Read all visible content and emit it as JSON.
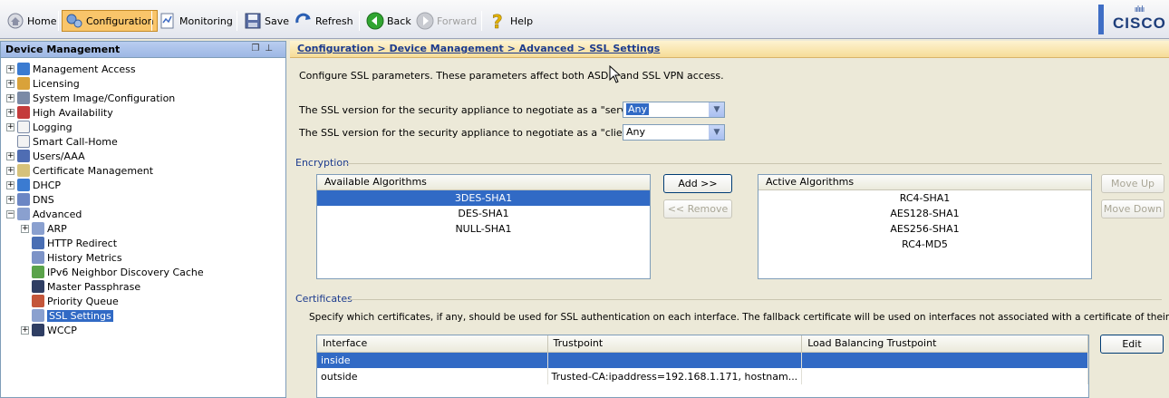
{
  "toolbar": {
    "home": "Home",
    "configuration": "Configuration",
    "monitoring": "Monitoring",
    "save": "Save",
    "refresh": "Refresh",
    "back": "Back",
    "forward": "Forward",
    "help": "Help",
    "brand": "CISCO",
    "brand_bars": "ıılıılı"
  },
  "sidebar": {
    "title": "Device Management",
    "items": [
      {
        "label": "Management Access",
        "icon": "network-icon"
      },
      {
        "label": "Licensing",
        "icon": "license-icon"
      },
      {
        "label": "System Image/Configuration",
        "icon": "system-image-icon"
      },
      {
        "label": "High Availability",
        "icon": "high-availability-icon"
      },
      {
        "label": "Logging",
        "icon": "logging-icon"
      },
      {
        "label": "Smart Call-Home",
        "icon": "call-home-icon"
      },
      {
        "label": "Users/AAA",
        "icon": "users-icon"
      },
      {
        "label": "Certificate Management",
        "icon": "certificate-icon"
      },
      {
        "label": "DHCP",
        "icon": "dhcp-icon"
      },
      {
        "label": "DNS",
        "icon": "dns-icon"
      },
      {
        "label": "Advanced",
        "icon": "advanced-icon"
      },
      {
        "label": "ARP",
        "icon": "arp-icon"
      },
      {
        "label": "HTTP Redirect",
        "icon": "http-redirect-icon"
      },
      {
        "label": "History Metrics",
        "icon": "history-metrics-icon"
      },
      {
        "label": "IPv6 Neighbor Discovery Cache",
        "icon": "ipv6-icon"
      },
      {
        "label": "Master Passphrase",
        "icon": "passphrase-icon"
      },
      {
        "label": "Priority Queue",
        "icon": "priority-queue-icon"
      },
      {
        "label": "SSL Settings",
        "icon": "ssl-icon"
      },
      {
        "label": "WCCP",
        "icon": "wccp-icon"
      }
    ]
  },
  "main": {
    "breadcrumb": "Configuration > Device Management > Advanced > SSL Settings",
    "description": "Configure SSL parameters. These parameters affect both ASDM and SSL VPN access.",
    "server_label": "The SSL version for the security appliance to negotiate as a \"server\":",
    "server_value": "Any",
    "client_label": "The SSL version for the security appliance to negotiate as a \"client\":",
    "client_value": "Any",
    "encryption": {
      "title": "Encryption",
      "available_header": "Available Algorithms",
      "available": [
        "3DES-SHA1",
        "DES-SHA1",
        "NULL-SHA1"
      ],
      "add_button": "Add >>",
      "remove_button": "<< Remove",
      "active_header": "Active Algorithms",
      "active": [
        "RC4-SHA1",
        "AES128-SHA1",
        "AES256-SHA1",
        "RC4-MD5"
      ],
      "move_up": "Move Up",
      "move_down": "Move Down"
    },
    "certificates": {
      "title": "Certificates",
      "description": "Specify which certificates, if any, should be used for SSL authentication on each interface. The fallback certificate will be used on interfaces not associated with a certificate of their own.",
      "columns": [
        "Interface",
        "Trustpoint",
        "Load Balancing Trustpoint"
      ],
      "rows": [
        {
          "interface": "inside",
          "trustpoint": "",
          "lb": ""
        },
        {
          "interface": "outside",
          "trustpoint": "Trusted-CA:ipaddress=192.168.1.171, hostnam...",
          "lb": ""
        }
      ],
      "edit_button": "Edit"
    }
  },
  "colors": {
    "selection": "#316ac5",
    "breadcrumb_text": "#1c3b8e",
    "active_tab": "#f9c56a"
  }
}
